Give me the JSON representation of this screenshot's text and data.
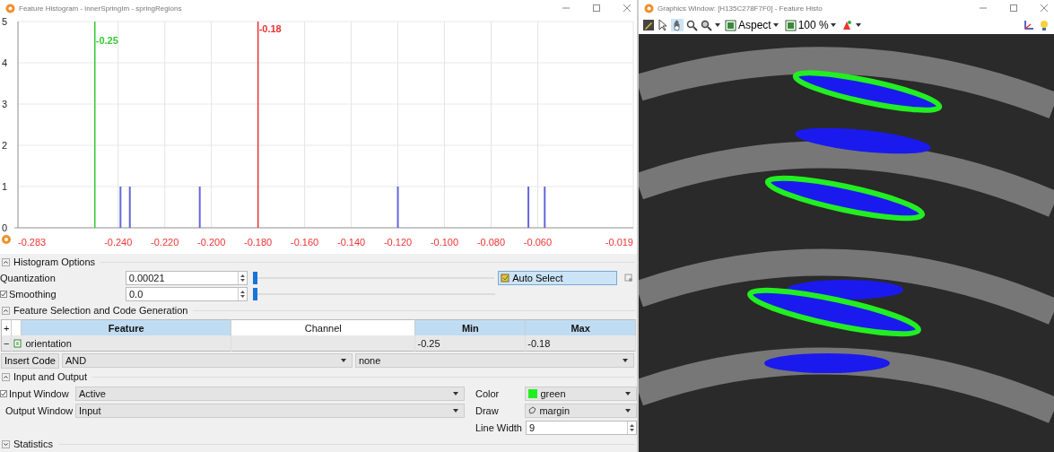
{
  "histogram_window": {
    "title": "Feature Histogram - innerSpringIm - springRegions",
    "chart_data": {
      "type": "bar",
      "x": [
        -0.239,
        -0.235,
        -0.205,
        -0.12,
        -0.064,
        -0.057
      ],
      "values": [
        1,
        1,
        1,
        1,
        1,
        1
      ],
      "grid": true,
      "xlim": [
        -0.283,
        -0.019
      ],
      "ylim": [
        0,
        5
      ],
      "xticks": [
        {
          "value": -0.283,
          "label": "-0.283"
        },
        {
          "value": -0.24,
          "label": "-0.240"
        },
        {
          "value": -0.22,
          "label": "-0.220"
        },
        {
          "value": -0.2,
          "label": "-0.200"
        },
        {
          "value": -0.18,
          "label": "-0.180"
        },
        {
          "value": -0.16,
          "label": "-0.160"
        },
        {
          "value": -0.14,
          "label": "-0.140"
        },
        {
          "value": -0.12,
          "label": "-0.120"
        },
        {
          "value": -0.1,
          "label": "-0.100"
        },
        {
          "value": -0.08,
          "label": "-0.080"
        },
        {
          "value": -0.06,
          "label": "-0.060"
        },
        {
          "value": -0.019,
          "label": "-0.019"
        }
      ],
      "yticks": [
        0,
        1,
        2,
        3,
        4,
        5
      ],
      "ref_lines": [
        {
          "axis": "x",
          "value": -0.25,
          "label": "-0.25",
          "color": "#33cc33"
        },
        {
          "axis": "x",
          "value": -0.18,
          "label": "-0.18",
          "color": "#ee3333"
        }
      ]
    }
  },
  "histogram_options": {
    "title": "Histogram Options",
    "expanded": true,
    "rows": [
      {
        "kind": "plain",
        "label": "Quantization",
        "value": "0.00021",
        "level": 0
      },
      {
        "kind": "checkbox",
        "label": "Smoothing",
        "checked": true,
        "value": "0.0",
        "level": 0
      }
    ],
    "auto_select": "Auto Select"
  },
  "feature_section": {
    "title": "Feature Selection and Code Generation",
    "expanded": true,
    "add_symbol": "+",
    "columns": [
      {
        "label": "Feature",
        "highlighted": true
      },
      {
        "label": "Channel",
        "highlighted": false
      },
      {
        "label": "Min",
        "highlighted": true
      },
      {
        "label": "Max",
        "highlighted": true
      }
    ],
    "rows": [
      {
        "remove_symbol": "−",
        "feature": "orientation",
        "min": "-0.25",
        "max": "-0.18"
      }
    ]
  },
  "insert_code": {
    "label": "Insert Code",
    "operator": "AND",
    "target": "none"
  },
  "input_output": {
    "title": "Input and Output",
    "expanded": true,
    "input_window": {
      "label": "Input Window",
      "checked": true,
      "value": "Active"
    },
    "output_window": {
      "label": "Output Window",
      "value": "Input"
    },
    "color": {
      "label": "Color",
      "value": "green",
      "color": "#22ee22"
    },
    "draw": {
      "label": "Draw",
      "value": "margin"
    },
    "line_width": {
      "label": "Line Width",
      "value": "9"
    }
  },
  "statistics": {
    "title": "Statistics",
    "expanded": false
  },
  "graphics_window": {
    "title": "Graphics Window: [H135C278F7F0] - Feature Histo",
    "aspect": "Aspect",
    "zoom": "100 %"
  }
}
